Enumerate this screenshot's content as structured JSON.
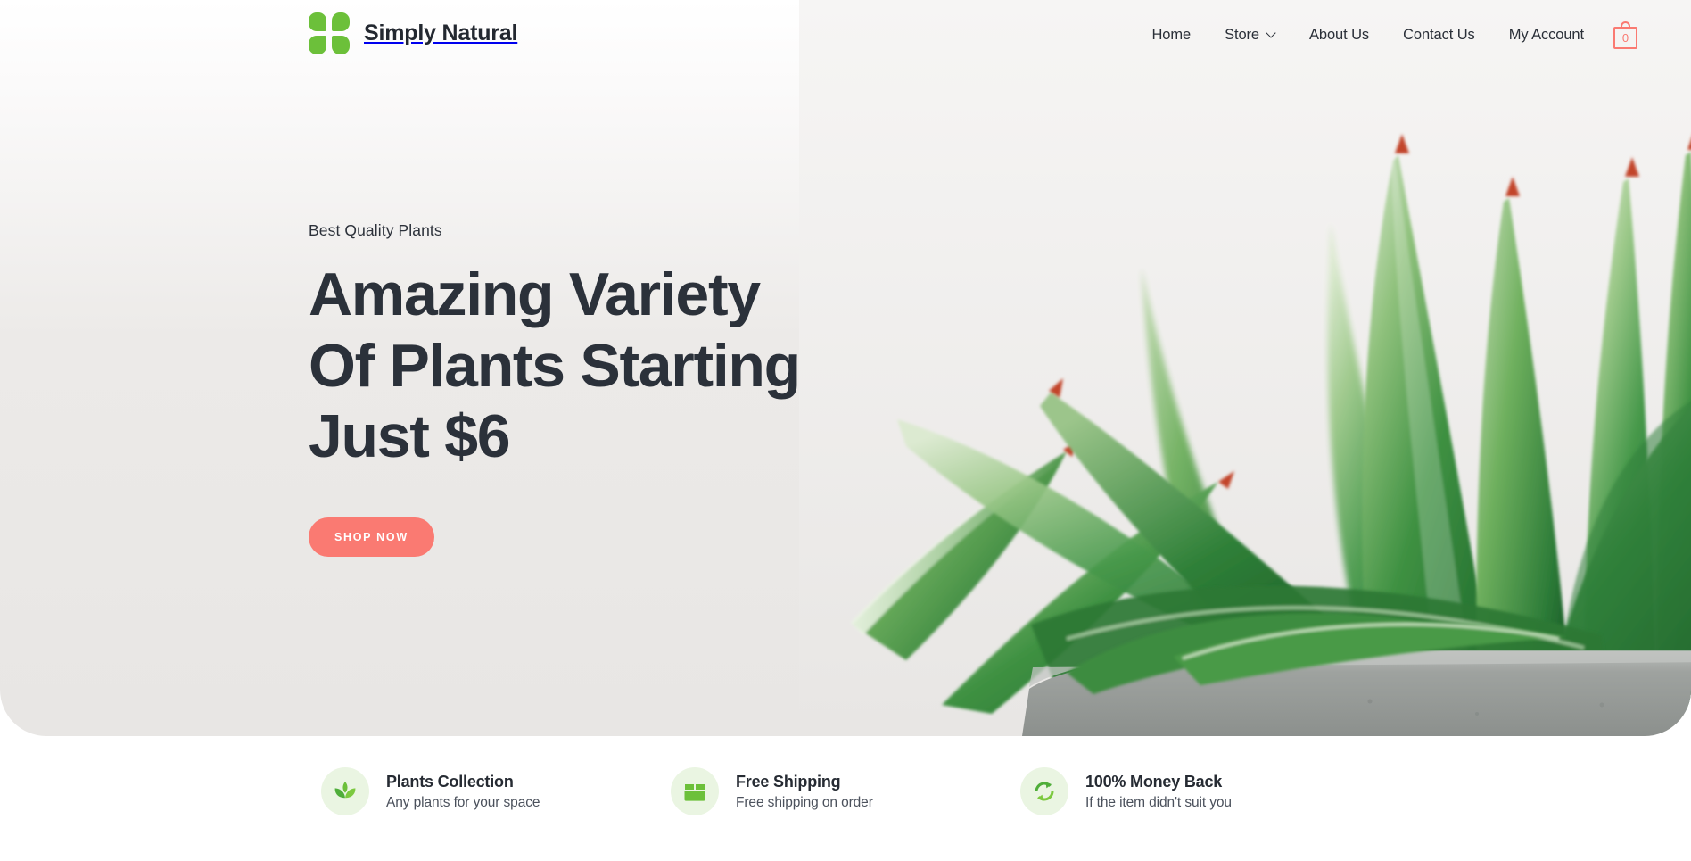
{
  "header": {
    "brand_name": "Simply Natural",
    "logo_icon": "four-leaf-clover-squares-logo",
    "logo_color": "#6cc03a",
    "nav": [
      {
        "label": "Home",
        "has_dropdown": false
      },
      {
        "label": "Store",
        "has_dropdown": true
      },
      {
        "label": "About Us",
        "has_dropdown": false
      },
      {
        "label": "Contact Us",
        "has_dropdown": false
      },
      {
        "label": "My Account",
        "has_dropdown": false
      }
    ],
    "cart": {
      "icon": "shopping-bag-icon",
      "count": "0",
      "color": "#fa7a72"
    }
  },
  "hero": {
    "eyebrow": "Best Quality Plants",
    "headline_line1": "Amazing Variety",
    "headline_line2": "Of Plants Starting",
    "headline_line3": "Just $6",
    "cta_label": "SHOP NOW",
    "cta_color": "#fa7a72",
    "background_color": "#e9e7e5",
    "image_subject": "green succulent agave plant in gray concrete pot"
  },
  "features": [
    {
      "icon": "leaf-plant-icon",
      "title": "Plants Collection",
      "subtitle": "Any plants for your space"
    },
    {
      "icon": "shipping-box-icon",
      "title": "Free Shipping",
      "subtitle": "Free shipping on order"
    },
    {
      "icon": "refresh-arrows-icon",
      "title": "100% Money Back",
      "subtitle": "If the item didn't suit you"
    }
  ],
  "theme": {
    "accent_green": "#6cc03a",
    "accent_coral": "#fa7a72",
    "text_dark": "#2b313a",
    "icon_circle_bg": "#eaf5e2"
  }
}
